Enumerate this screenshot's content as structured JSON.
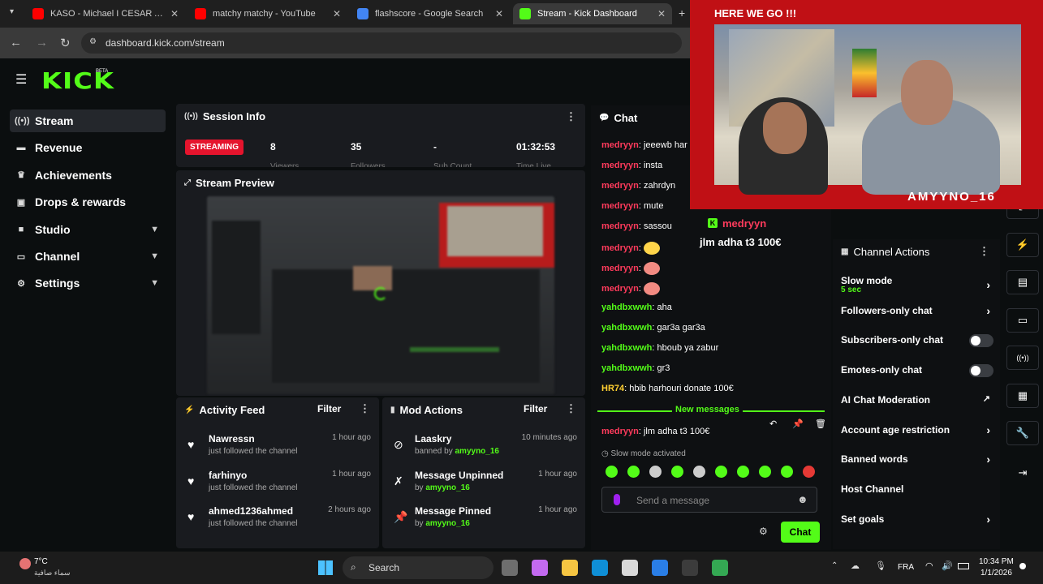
{
  "browser": {
    "tabs": [
      {
        "title": "KASO - Michael I CESAR ART S...",
        "color": "#ff0000",
        "active": false
      },
      {
        "title": "matchy matchy - YouTube",
        "color": "#ff0000",
        "active": false
      },
      {
        "title": "flashscore - Google Search",
        "color": "#4285f4",
        "active": false
      },
      {
        "title": "Stream - Kick Dashboard",
        "color": "#53fc18",
        "active": true
      }
    ],
    "url": "dashboard.kick.com/stream"
  },
  "brand": {
    "logo": "KICK",
    "beta": "BETA",
    "accent": "#53fc18"
  },
  "sidebar": {
    "items": [
      {
        "label": "Stream",
        "icon": "broadcast-icon",
        "chevron": false,
        "active": true
      },
      {
        "label": "Revenue",
        "icon": "money-icon",
        "chevron": false,
        "active": false
      },
      {
        "label": "Achievements",
        "icon": "trophy-icon",
        "chevron": false,
        "active": false
      },
      {
        "label": "Drops & rewards",
        "icon": "gift-icon",
        "chevron": false,
        "active": false
      },
      {
        "label": "Studio",
        "icon": "camera-icon",
        "chevron": true,
        "active": false
      },
      {
        "label": "Channel",
        "icon": "channel-icon",
        "chevron": true,
        "active": false
      },
      {
        "label": "Settings",
        "icon": "gear-icon",
        "chevron": true,
        "active": false
      }
    ]
  },
  "session": {
    "title": "Session Info",
    "status": "STREAMING",
    "stats": [
      {
        "value": "8",
        "label": "Viewers"
      },
      {
        "value": "35",
        "label": "Followers"
      },
      {
        "value": "-",
        "label": "Sub Count"
      },
      {
        "value": "01:32:53",
        "label": "Time Live"
      }
    ]
  },
  "preview": {
    "title": "Stream Preview"
  },
  "activity": {
    "title": "Activity Feed",
    "filter": "Filter",
    "items": [
      {
        "name": "Nawressn",
        "sub": "just followed the channel",
        "time": "1 hour ago"
      },
      {
        "name": "farhinyo",
        "sub": "just followed the channel",
        "time": "1 hour ago"
      },
      {
        "name": "ahmed1236ahmed",
        "sub": "just followed the channel",
        "time": "2 hours ago"
      }
    ]
  },
  "mod": {
    "title": "Mod Actions",
    "filter": "Filter",
    "items": [
      {
        "name": "Laaskry",
        "sub_prefix": "banned by ",
        "sub_user": "amyyno_16",
        "time": "10 minutes ago",
        "icon": "ban-icon"
      },
      {
        "name": "Message Unpinned",
        "sub_prefix": "by ",
        "sub_user": "amyyno_16",
        "time": "1 hour ago",
        "icon": "unpin-icon"
      },
      {
        "name": "Message Pinned",
        "sub_prefix": "by ",
        "sub_user": "amyyno_16",
        "time": "1 hour ago",
        "icon": "pin-icon"
      }
    ]
  },
  "chat": {
    "title": "Chat",
    "messages": [
      {
        "user": "medryyn",
        "text": "jeeewb har",
        "color": "r"
      },
      {
        "user": "medryyn",
        "text": "insta",
        "color": "r"
      },
      {
        "user": "medryyn",
        "text": "zahrdyn",
        "color": "r"
      },
      {
        "user": "medryyn",
        "text": "mute",
        "color": "r"
      },
      {
        "user": "medryyn",
        "text": "sassou",
        "color": "r"
      },
      {
        "user": "medryyn",
        "text": "",
        "color": "r",
        "emote": "#ffd54a"
      },
      {
        "user": "medryyn",
        "text": "",
        "color": "r",
        "emote": "#f28b82"
      },
      {
        "user": "medryyn",
        "text": "",
        "color": "r",
        "emote": "#f28b82"
      },
      {
        "user": "yahdbxwwh",
        "text": "aha",
        "color": "g"
      },
      {
        "user": "yahdbxwwh",
        "text": "gar3a gar3a",
        "color": "g"
      },
      {
        "user": "yahdbxwwh",
        "text": "hboub ya zabur",
        "color": "g"
      },
      {
        "user": "yahdbxwwh",
        "text": "gr3",
        "color": "g"
      },
      {
        "user": "HR74",
        "text": "hbib harhouri donate 100€",
        "color": "y"
      }
    ],
    "new_messages": "New messages",
    "last": {
      "user": "medryyn",
      "text": "jlm adha t3 100€"
    },
    "slow_mode": "Slow mode activated",
    "placeholder": "Send a message",
    "send": "Chat"
  },
  "pinned": {
    "user": "medryyn",
    "text": "jlm adha t3 100€"
  },
  "channel_actions": {
    "title": "Channel Actions",
    "items": [
      {
        "label": "Slow mode",
        "sub": "5 sec",
        "kind": "arrow"
      },
      {
        "label": "Followers-only chat",
        "sub": "",
        "kind": "arrow"
      },
      {
        "label": "Subscribers-only chat",
        "sub": "",
        "kind": "toggle"
      },
      {
        "label": "Emotes-only chat",
        "sub": "",
        "kind": "toggle"
      },
      {
        "label": "AI Chat Moderation",
        "sub": "",
        "kind": "external"
      },
      {
        "label": "Account age restriction",
        "sub": "",
        "kind": "arrow"
      },
      {
        "label": "Banned words",
        "sub": "",
        "kind": "arrow"
      },
      {
        "label": "Host Channel",
        "sub": "",
        "kind": "none"
      },
      {
        "label": "Set goals",
        "sub": "",
        "kind": "arrow"
      }
    ]
  },
  "overlay": {
    "caption": "HERE WE GO !!!",
    "handle": "AMYYNO_16"
  },
  "taskbar": {
    "weather_temp": "7°C",
    "weather_desc": "سماء صافية",
    "search": "Search",
    "lang": "FRA",
    "time": "10:34 PM",
    "date": "1/1/2026"
  }
}
